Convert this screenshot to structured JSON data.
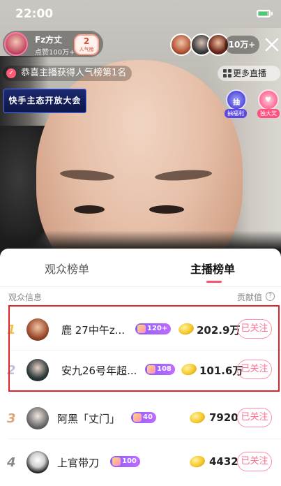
{
  "status": {
    "time": "22:00"
  },
  "host": {
    "name": "Fz方丈",
    "likes": "点赞100万+",
    "badge_num": "2",
    "badge_sub": "人气榜"
  },
  "viewers": {
    "count": "10万+"
  },
  "notice": {
    "text": "恭喜主播获得人气榜第1名"
  },
  "more_live": {
    "label": "更多直播"
  },
  "banner": {
    "text": "快手主态开放大会"
  },
  "activities": [
    {
      "inner": "抽",
      "label": "抽福利"
    },
    {
      "inner": "♥",
      "label": "独大奖"
    }
  ],
  "tabs": [
    {
      "label": "观众榜单"
    },
    {
      "label": "主播榜单"
    }
  ],
  "columns": {
    "left": "观众信息",
    "right": "贡献值",
    "info": "?"
  },
  "rows": [
    {
      "rank": "1",
      "name": "鹿 27中午z...",
      "level": "120+",
      "value": "202.9万",
      "follow": "已关注",
      "rank_color": "#f0c24b"
    },
    {
      "rank": "2",
      "name": "安九26号年超...",
      "level": "108",
      "value": "101.6万",
      "follow": "已关注",
      "rank_color": "#b9c3d3"
    },
    {
      "rank": "3",
      "name": "阿黑「丈门」",
      "level": "40",
      "value": "7920",
      "follow": "已关注",
      "rank_color": "#d9a878"
    },
    {
      "rank": "4",
      "name": "上官带刀",
      "level": "100",
      "value": "4432",
      "follow": "已关注",
      "rank_color": "#888888"
    }
  ],
  "colors": {
    "accent": "#ff4f6e",
    "highlight": "#e0242b"
  }
}
